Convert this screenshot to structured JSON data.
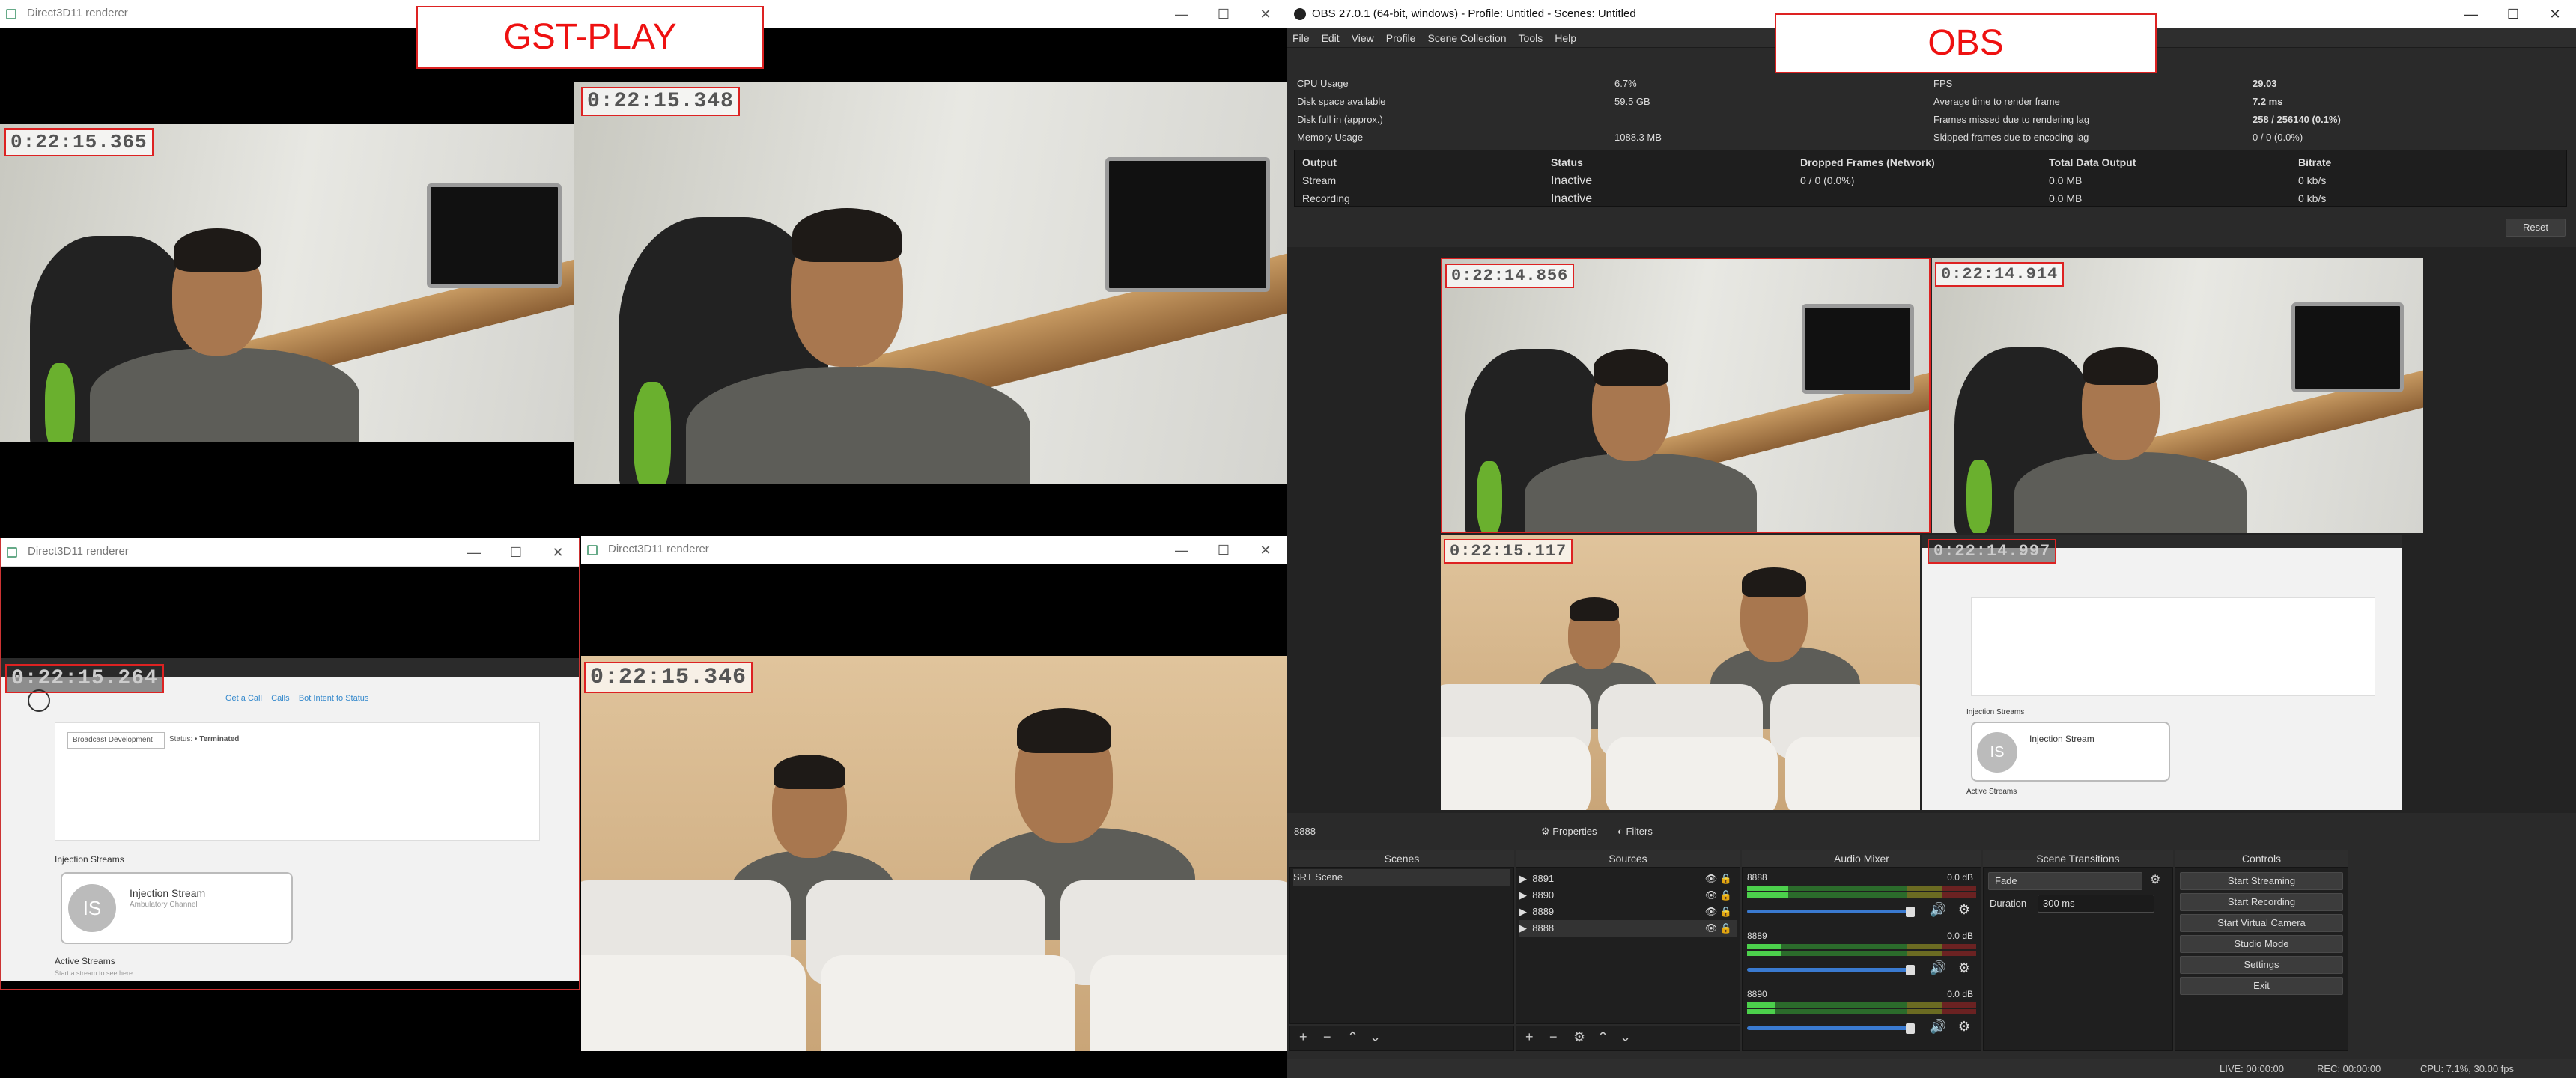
{
  "annotations": {
    "left_label": "GST-PLAY",
    "right_label": "OBS"
  },
  "gst_windows": {
    "w1": {
      "title": "Direct3D11 renderer",
      "timestamp": "0:22:15.365"
    },
    "w2": {
      "timestamp": "0:22:15.348"
    },
    "w3": {
      "title": "Direct3D11 renderer",
      "timestamp": "0:22:15.264"
    },
    "w4": {
      "title": "Direct3D11 renderer",
      "timestamp": "0:22:15.346"
    }
  },
  "web_capture": {
    "dropdown": "Broadcast Development",
    "status_label": "Status:",
    "status_value": "Terminated",
    "links": [
      "Get a Call",
      "Calls",
      "Bot Intent to Status"
    ],
    "section_injection": "Injection Streams",
    "initials": "IS",
    "card_title": "Injection Stream",
    "card_sub": "Ambulatory Channel",
    "section_active": "Active Streams",
    "active_sub": "Start a stream to see here"
  },
  "obs": {
    "title": "OBS 27.0.1 (64-bit, windows) - Profile: Untitled - Scenes: Untitled",
    "menu": [
      "File",
      "Edit",
      "View",
      "Profile",
      "Scene Collection",
      "Tools",
      "Help"
    ],
    "stats_left": [
      {
        "label": "CPU Usage",
        "value": "6.7%"
      },
      {
        "label": "Disk space available",
        "value": "59.5 GB"
      },
      {
        "label": "Disk full in (approx.)",
        "value": ""
      },
      {
        "label": "Memory Usage",
        "value": "1088.3 MB"
      }
    ],
    "stats_right": [
      {
        "label": "FPS",
        "value": "29.03"
      },
      {
        "label": "Average time to render frame",
        "value": "7.2 ms"
      },
      {
        "label": "Frames missed due to rendering lag",
        "value": "258 / 256140 (0.1%)"
      },
      {
        "label": "Skipped frames due to encoding lag",
        "value": "0 / 0 (0.0%)"
      }
    ],
    "output_headers": [
      "Output",
      "Status",
      "Dropped Frames (Network)",
      "Total Data Output",
      "Bitrate"
    ],
    "output_rows": [
      [
        "Stream",
        "Inactive",
        "0 / 0 (0.0%)",
        "0.0 MB",
        "0 kb/s"
      ],
      [
        "Recording",
        "Inactive",
        "",
        "0.0 MB",
        "0 kb/s"
      ]
    ],
    "reset": "Reset",
    "preview_timestamps": [
      "0:22:14.856",
      "0:22:14.914",
      "0:22:15.117",
      "0:22:14.997"
    ],
    "selected_source": "8888",
    "properties": "Properties",
    "filters": "Filters",
    "docks": {
      "scenes": "Scenes",
      "sources": "Sources",
      "mixer": "Audio Mixer",
      "transitions": "Scene Transitions",
      "controls": "Controls"
    },
    "scenes": [
      "SRT Scene"
    ],
    "sources": [
      "8891",
      "8890",
      "8889",
      "8888"
    ],
    "mixer": [
      {
        "name": "8888",
        "db": "0.0 dB",
        "level": 0.18
      },
      {
        "name": "8889",
        "db": "0.0 dB",
        "level": 0.15
      },
      {
        "name": "8890",
        "db": "0.0 dB",
        "level": 0.12
      }
    ],
    "meter_ticks": [
      "-60",
      "-55",
      "-50",
      "-45",
      "-40",
      "-35",
      "-30",
      "-25",
      "-20",
      "-15",
      "-10",
      "-5",
      "0"
    ],
    "transition": "Fade",
    "duration_label": "Duration",
    "duration": "300 ms",
    "controls": [
      "Start Streaming",
      "Start Recording",
      "Start Virtual Camera",
      "Studio Mode",
      "Settings",
      "Exit"
    ],
    "status": {
      "live": "LIVE: 00:00:00",
      "rec": "REC: 00:00:00",
      "cpu": "CPU: 7.1%, 30.00 fps"
    }
  }
}
